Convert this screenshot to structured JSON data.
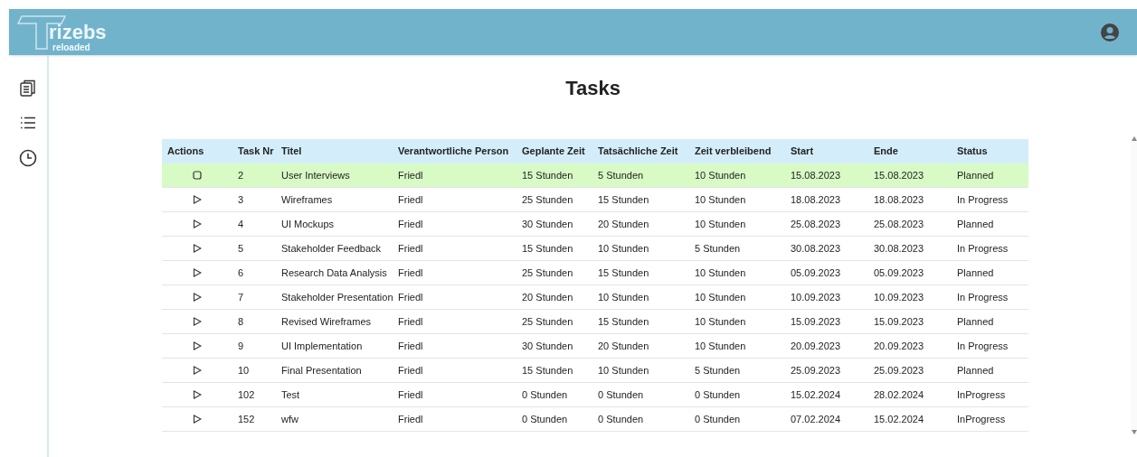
{
  "logo": {
    "title": "rizebs",
    "subtitle": "reloaded"
  },
  "page_title": "Tasks",
  "table": {
    "columns": [
      "Actions",
      "Task Nr",
      "Titel",
      "Verantwortliche Person",
      "Geplante Zeit",
      "Tatsächliche Zeit",
      "Zeit verbleibend",
      "Start",
      "Ende",
      "Status"
    ],
    "rows": [
      {
        "selected": true,
        "cells": [
          "",
          "2",
          "User Interviews",
          "Friedl",
          "15 Stunden",
          "5 Stunden",
          "10 Stunden",
          "15.08.2023",
          "15.08.2023",
          "Planned"
        ]
      },
      {
        "selected": false,
        "cells": [
          "",
          "3",
          "Wireframes",
          "Friedl",
          "25 Stunden",
          "15 Stunden",
          "10 Stunden",
          "18.08.2023",
          "18.08.2023",
          "In Progress"
        ]
      },
      {
        "selected": false,
        "cells": [
          "",
          "4",
          "UI Mockups",
          "Friedl",
          "30 Stunden",
          "20 Stunden",
          "10 Stunden",
          "25.08.2023",
          "25.08.2023",
          "Planned"
        ]
      },
      {
        "selected": false,
        "cells": [
          "",
          "5",
          "Stakeholder Feedback",
          "Friedl",
          "15 Stunden",
          "10 Stunden",
          "5 Stunden",
          "30.08.2023",
          "30.08.2023",
          "In Progress"
        ]
      },
      {
        "selected": false,
        "cells": [
          "",
          "6",
          "Research Data Analysis",
          "Friedl",
          "25 Stunden",
          "15 Stunden",
          "10 Stunden",
          "05.09.2023",
          "05.09.2023",
          "Planned"
        ]
      },
      {
        "selected": false,
        "cells": [
          "",
          "7",
          "Stakeholder Presentation",
          "Friedl",
          "20 Stunden",
          "10 Stunden",
          "10 Stunden",
          "10.09.2023",
          "10.09.2023",
          "In Progress"
        ]
      },
      {
        "selected": false,
        "cells": [
          "",
          "8",
          "Revised Wireframes",
          "Friedl",
          "25 Stunden",
          "15 Stunden",
          "10 Stunden",
          "15.09.2023",
          "15.09.2023",
          "Planned"
        ]
      },
      {
        "selected": false,
        "cells": [
          "",
          "9",
          "UI Implementation",
          "Friedl",
          "30 Stunden",
          "20 Stunden",
          "10 Stunden",
          "20.09.2023",
          "20.09.2023",
          "In Progress"
        ]
      },
      {
        "selected": false,
        "cells": [
          "",
          "10",
          "Final Presentation",
          "Friedl",
          "15 Stunden",
          "10 Stunden",
          "5 Stunden",
          "25.09.2023",
          "25.09.2023",
          "Planned"
        ]
      },
      {
        "selected": false,
        "cells": [
          "",
          "102",
          "Test",
          "Friedl",
          "0 Stunden",
          "0 Stunden",
          "0 Stunden",
          "15.02.2024",
          "28.02.2024",
          "InProgress"
        ]
      },
      {
        "selected": false,
        "cells": [
          "",
          "152",
          "wfw",
          "Friedl",
          "0 Stunden",
          "0 Stunden",
          "0 Stunden",
          "07.02.2024",
          "15.02.2024",
          "InProgress"
        ]
      }
    ]
  }
}
